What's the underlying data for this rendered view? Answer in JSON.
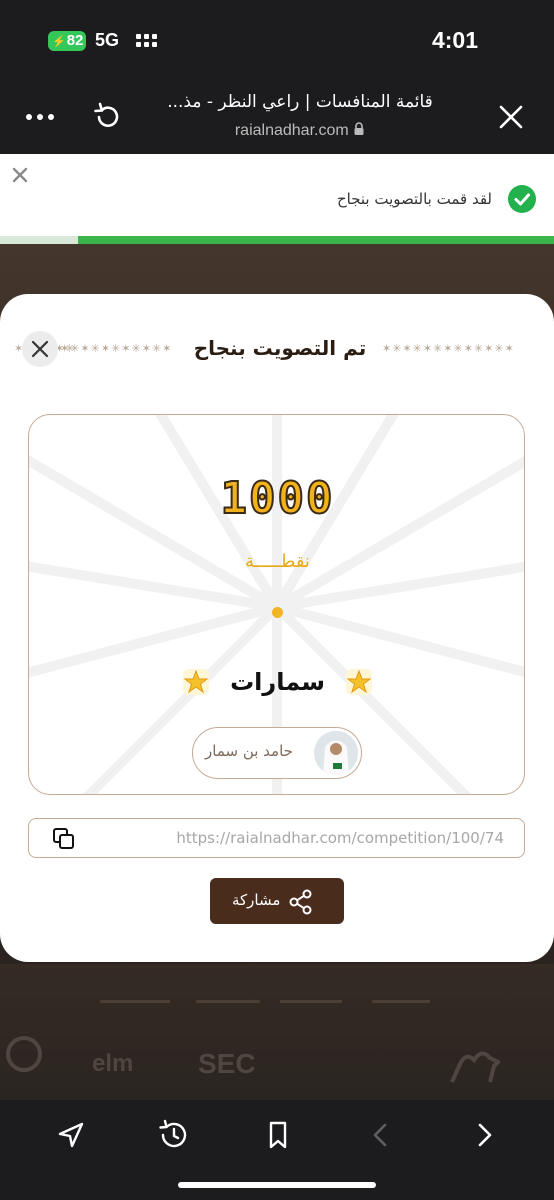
{
  "status_bar": {
    "battery": "82",
    "network": "5G",
    "time": "4:01"
  },
  "browser": {
    "page_title": "قائمة المنافسات | راعي النظر - مذ...",
    "domain": "raialnadhar.com",
    "icons": [
      "more-icon",
      "reload-icon",
      "lock-icon",
      "close-icon"
    ]
  },
  "toast": {
    "message": "لقد قمت بالتصويت بنجاح",
    "progress": 0.86,
    "colors": {
      "success": "#22b14c",
      "track": "#d9e9d9"
    }
  },
  "modal": {
    "title": "تم التصويت بنجاح",
    "ornament": "✶✳✶✳✶✳✶✳✶✳✶✳✶",
    "points": "1000",
    "points_label": "نقطـــــة",
    "category": "سمارات",
    "owner_name": "حامد بن سمار",
    "link": "https://raialnadhar.com/competition/100/74",
    "share_label": "مشاركة",
    "colors": {
      "brand": "#4a2c1c",
      "gold": "#f2b21b",
      "border": "#c5ab96"
    }
  },
  "footer": {
    "logos": [
      "SEC",
      "elm"
    ]
  }
}
